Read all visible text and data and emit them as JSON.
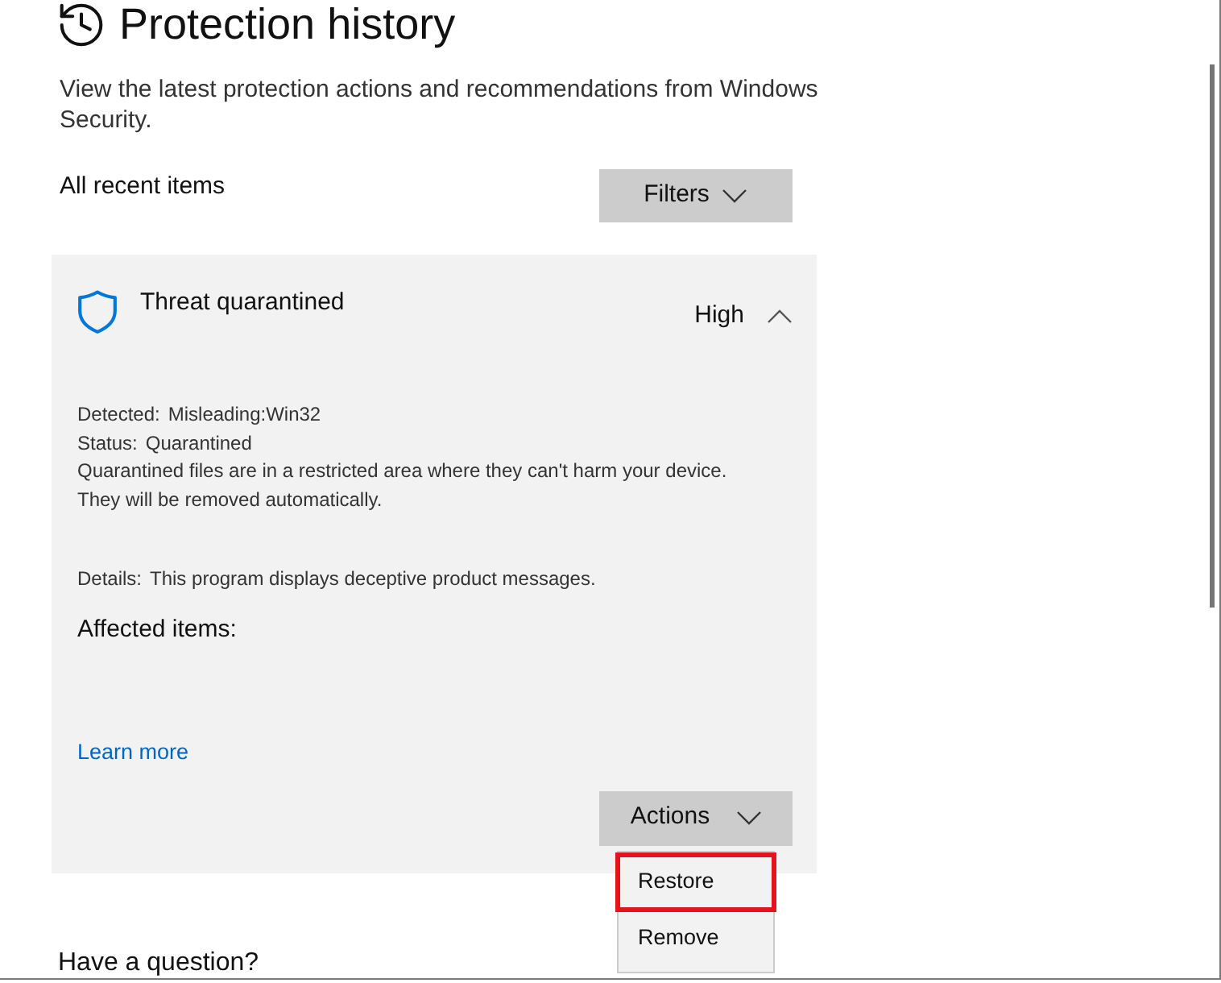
{
  "page": {
    "title": "Protection history",
    "description": "View the latest protection actions and recommendations from Windows Security."
  },
  "list_header": {
    "label": "All recent items",
    "filter_button": "Filters"
  },
  "threat_card": {
    "title": "Threat quarantined",
    "severity": "High",
    "expanded": true,
    "fields": [
      {
        "label": "Detected:",
        "value": "Misleading:Win32"
      },
      {
        "label": "Status:",
        "value": "Quarantined"
      }
    ],
    "note": "Quarantined files are in a restricted area where they can't harm your device. They will be removed automatically.",
    "details": {
      "label": "Details:",
      "value": "This program displays deceptive product messages."
    },
    "affected_heading": "Affected items:",
    "link": "Learn more",
    "actions_button": "Actions",
    "actions_menu": {
      "open": true,
      "items": [
        {
          "label": "Restore",
          "highlighted": true
        },
        {
          "label": "Remove",
          "highlighted": false
        }
      ]
    }
  },
  "footer": {
    "question": "Have a question?"
  }
}
